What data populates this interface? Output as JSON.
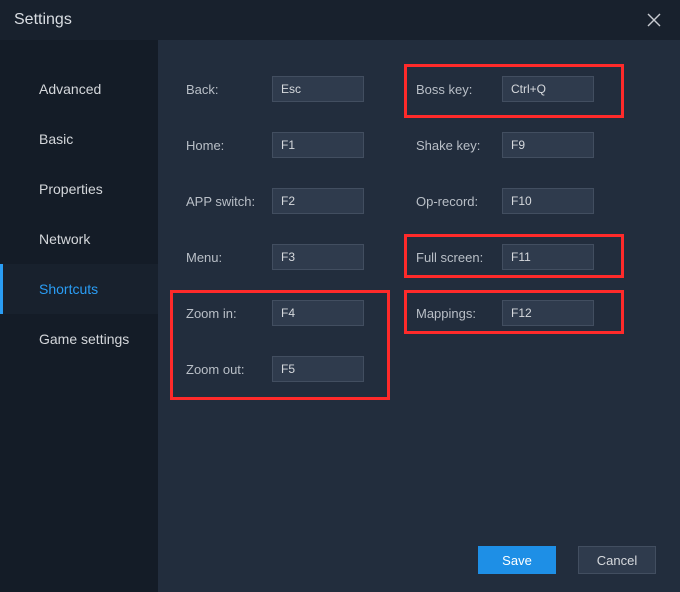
{
  "window": {
    "title": "Settings"
  },
  "sidebar": {
    "items": [
      {
        "label": "Advanced"
      },
      {
        "label": "Basic"
      },
      {
        "label": "Properties"
      },
      {
        "label": "Network"
      },
      {
        "label": "Shortcuts"
      },
      {
        "label": "Game settings"
      }
    ],
    "active_index": 4
  },
  "shortcuts": {
    "left": [
      {
        "label": "Back:",
        "value": "Esc"
      },
      {
        "label": "Home:",
        "value": "F1"
      },
      {
        "label": "APP switch:",
        "value": "F2"
      },
      {
        "label": "Menu:",
        "value": "F3"
      },
      {
        "label": "Zoom in:",
        "value": "F4"
      },
      {
        "label": "Zoom out:",
        "value": "F5"
      }
    ],
    "right": [
      {
        "label": "Boss key:",
        "value": "Ctrl+Q"
      },
      {
        "label": "Shake key:",
        "value": "F9"
      },
      {
        "label": "Op-record:",
        "value": "F10"
      },
      {
        "label": "Full screen:",
        "value": "F11"
      },
      {
        "label": "Mappings:",
        "value": "F12"
      }
    ]
  },
  "footer": {
    "save": "Save",
    "cancel": "Cancel"
  }
}
